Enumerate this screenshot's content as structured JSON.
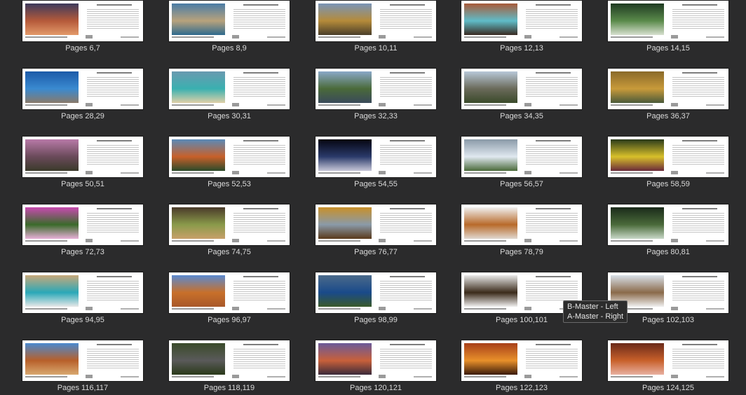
{
  "spreads": [
    {
      "pages": "Pages 6,7",
      "photo_colors": [
        "#3d3a5c",
        "#b55a3a",
        "#e39a6a"
      ]
    },
    {
      "pages": "Pages 8,9",
      "photo_colors": [
        "#4a7ca6",
        "#b8a27c",
        "#2e6a8e"
      ]
    },
    {
      "pages": "Pages 10,11",
      "photo_colors": [
        "#7a95b8",
        "#b58b3a",
        "#4a3e2a"
      ]
    },
    {
      "pages": "Pages 12,13",
      "photo_colors": [
        "#a85a3a",
        "#5fbcc8",
        "#3a2a22"
      ]
    },
    {
      "pages": "Pages 14,15",
      "photo_colors": [
        "#1f3a22",
        "#5a8a4a",
        "#d8e0d0"
      ]
    },
    {
      "pages": "Pages 28,29",
      "photo_colors": [
        "#1c5aa8",
        "#3a8ad0",
        "#8a7a6a"
      ]
    },
    {
      "pages": "Pages 30,31",
      "photo_colors": [
        "#6a9ab0",
        "#3ab0b0",
        "#e0d0a8"
      ]
    },
    {
      "pages": "Pages 32,33",
      "photo_colors": [
        "#8aa8c8",
        "#4a6a3a",
        "#3a4a5a"
      ]
    },
    {
      "pages": "Pages 34,35",
      "photo_colors": [
        "#b8c8d8",
        "#6a6a5a",
        "#3a4a2a"
      ]
    },
    {
      "pages": "Pages 36,37",
      "photo_colors": [
        "#8a6a2a",
        "#c89a3a",
        "#4a5a3a"
      ]
    },
    {
      "pages": "Pages 50,51",
      "photo_colors": [
        "#b87aa8",
        "#6a4a5a",
        "#3a3a2a"
      ]
    },
    {
      "pages": "Pages 52,53",
      "photo_colors": [
        "#5a8ab8",
        "#c8602a",
        "#2a4a2a"
      ]
    },
    {
      "pages": "Pages 54,55",
      "photo_colors": [
        "#050510",
        "#2a3a6a",
        "#c8c8d8"
      ]
    },
    {
      "pages": "Pages 56,57",
      "photo_colors": [
        "#8a9aa8",
        "#e0e8f0",
        "#4a6a3a"
      ]
    },
    {
      "pages": "Pages 58,59",
      "photo_colors": [
        "#2a3a1a",
        "#d8c02a",
        "#6a2a3a"
      ]
    },
    {
      "pages": "Pages 72,73",
      "photo_colors": [
        "#c84ab0",
        "#3a6a2a",
        "#e8b0d8"
      ]
    },
    {
      "pages": "Pages 74,75",
      "photo_colors": [
        "#4a3a2a",
        "#8a9a4a",
        "#c8a06a"
      ]
    },
    {
      "pages": "Pages 76,77",
      "photo_colors": [
        "#c8902a",
        "#8a9aa8",
        "#5a3a1a"
      ]
    },
    {
      "pages": "Pages 78,79",
      "photo_colors": [
        "#f0f0f0",
        "#b86a2a",
        "#e0d8d0"
      ]
    },
    {
      "pages": "Pages 80,81",
      "photo_colors": [
        "#1a2a1a",
        "#4a6a3a",
        "#c8d8c8"
      ]
    },
    {
      "pages": "Pages 94,95",
      "photo_colors": [
        "#c8a87a",
        "#2aa8b8",
        "#e8e8e8"
      ]
    },
    {
      "pages": "Pages 96,97",
      "photo_colors": [
        "#5a8ad0",
        "#c8702a",
        "#a8582a"
      ]
    },
    {
      "pages": "Pages 98,99",
      "photo_colors": [
        "#4a6a8a",
        "#1a4a8a",
        "#3a5a2a"
      ]
    },
    {
      "pages": "Pages 100,101",
      "photo_colors": [
        "#e8e8e8",
        "#3a2a1a",
        "#f0f0f0"
      ]
    },
    {
      "pages": "Pages 102,103",
      "photo_colors": [
        "#d8e0e8",
        "#8a6a4a",
        "#f0f0f0"
      ]
    },
    {
      "pages": "Pages 116,117",
      "photo_colors": [
        "#4a8ad0",
        "#b8602a",
        "#d8a870"
      ]
    },
    {
      "pages": "Pages 118,119",
      "photo_colors": [
        "#3a4a2a",
        "#5a5a5a",
        "#2a3a1a"
      ]
    },
    {
      "pages": "Pages 120,121",
      "photo_colors": [
        "#6a5a9a",
        "#c8603a",
        "#3a2a3a"
      ]
    },
    {
      "pages": "Pages 122,123",
      "photo_colors": [
        "#a8401a",
        "#e8902a",
        "#3a1a0a"
      ]
    },
    {
      "pages": "Pages 124,125",
      "photo_colors": [
        "#6a2a1a",
        "#c8602a",
        "#e8b0a0"
      ]
    }
  ],
  "tooltip": {
    "line1": "B-Master - Left",
    "line2": "A-Master - Right"
  }
}
